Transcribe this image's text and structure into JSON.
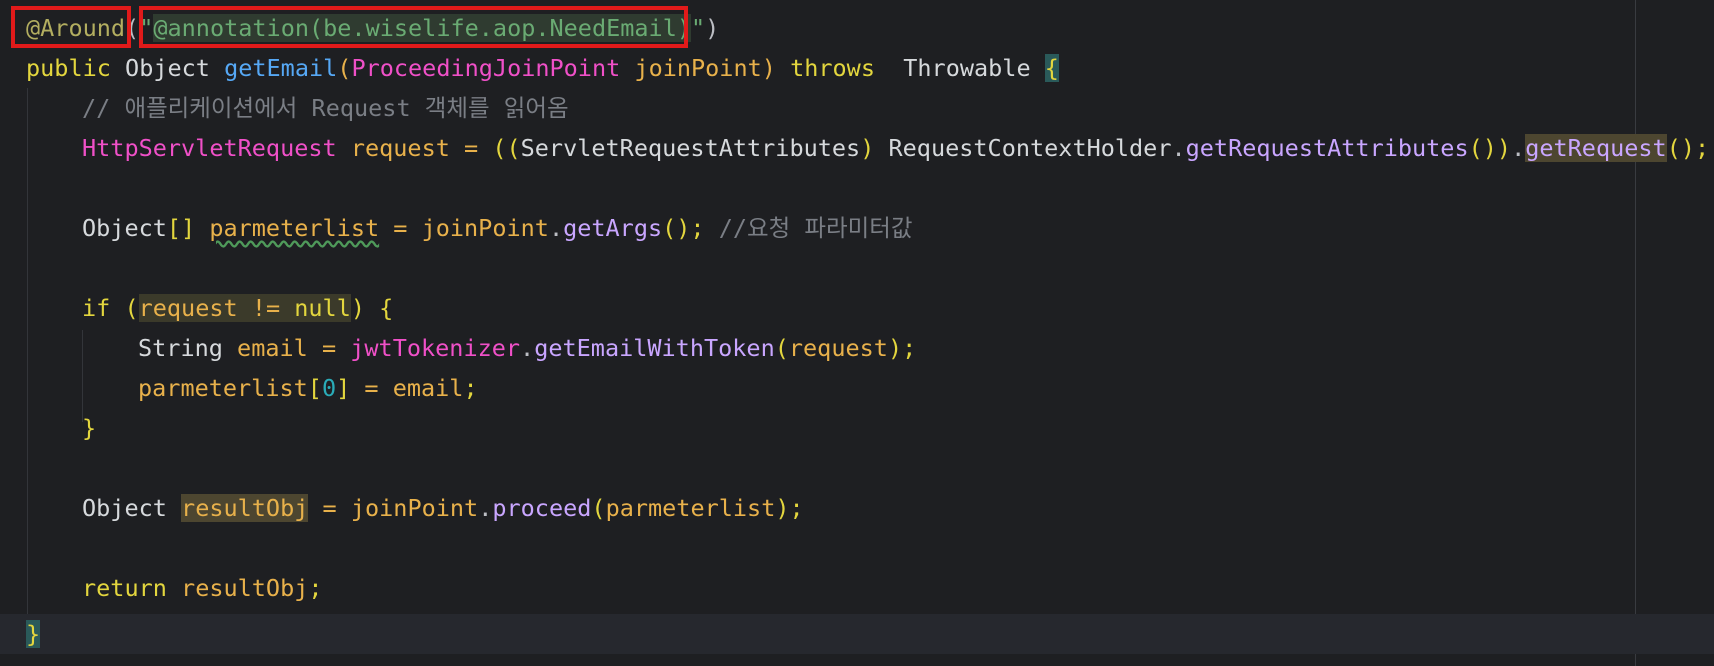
{
  "code": {
    "l1": {
      "ann": "@Around",
      "open": "(",
      "q1": "\"",
      "str": "@annotation(be.wiselife.aop.NeedEmail)",
      "q2": "\"",
      "close": ")"
    },
    "l2": {
      "kw_public": "public",
      "type_obj": "Object",
      "method": "getEmail",
      "p_open": "(",
      "param_type": "ProceedingJoinPoint",
      "param_name": "joinPoint",
      "p_close": ")",
      "kw_throws": "throws",
      "throwable": "Throwable",
      "brace": "{"
    },
    "l3": {
      "comment": "// 애플리케이션에서 Request 객체를 읽어옴"
    },
    "l4": {
      "type": "HttpServletRequest",
      "var": "request",
      "eq": "=",
      "open": "((",
      "cast": "ServletRequestAttributes",
      "close_cast": ")",
      "holder": "RequestContextHolder",
      "dot1": ".",
      "m1": "getRequestAttributes",
      "m1_parens": "())",
      "dot2": ".",
      "m2": "getRequest",
      "end": "();"
    },
    "l6": {
      "type": "Object",
      "brackets": "[]",
      "var": "parmeterlist",
      "eq": "=",
      "jp": "joinPoint",
      "dot": ".",
      "m": "getArgs",
      "end": "();",
      "comment": "//요청 파라미터값"
    },
    "l8": {
      "kw_if": "if",
      "open": "(",
      "req": "request",
      "neq": "!=",
      "null": "null",
      "close": ")",
      "brace": "{"
    },
    "l9": {
      "type": "String",
      "var": "email",
      "eq": "=",
      "field": "jwtTokenizer",
      "dot": ".",
      "m": "getEmailWithToken",
      "open": "(",
      "arg": "request",
      "end": ");"
    },
    "l10": {
      "var": "parmeterlist",
      "open": "[",
      "idx": "0",
      "close": "]",
      "eq": "=",
      "val": "email",
      "semi": ";"
    },
    "l11": {
      "brace": "}"
    },
    "l13": {
      "type": "Object",
      "var": "resultObj",
      "eq": "=",
      "jp": "joinPoint",
      "dot": ".",
      "m": "proceed",
      "open": "(",
      "arg": "parmeterlist",
      "end": ");"
    },
    "l15": {
      "kw": "return",
      "var": "resultObj",
      "semi": ";"
    },
    "l16": {
      "brace": "}"
    }
  },
  "colors": {
    "background": "#1e1f22",
    "highlight_box": "#e11a1a",
    "current_line": "#26282e"
  }
}
